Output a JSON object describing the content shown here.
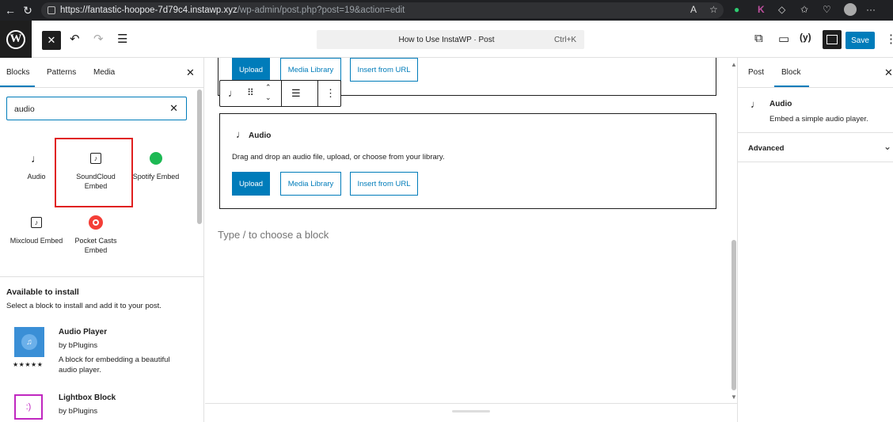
{
  "browser": {
    "url_host": "https://fantastic-hoopoe-7d79c4.instawp.xyz",
    "url_path": "/wp-admin/post.php?post=19&action=edit"
  },
  "topbar": {
    "doc_title": "How to Use InstaWP · Post",
    "shortcut": "Ctrl+K",
    "save_label": "Save"
  },
  "inserter": {
    "tabs": [
      "Blocks",
      "Patterns",
      "Media"
    ],
    "search_value": "audio",
    "results": [
      {
        "label": "Audio"
      },
      {
        "label": "SoundCloud Embed"
      },
      {
        "label": "Spotify Embed"
      },
      {
        "label": "Mixcloud Embed"
      },
      {
        "label": "Pocket Casts Embed"
      }
    ],
    "install_heading": "Available to install",
    "install_sub": "Select a block to install and add it to your post.",
    "plugins": [
      {
        "name": "Audio Player",
        "author": "by bPlugins",
        "desc": "A block for embedding a beautiful audio player.",
        "stars": "★★★★★"
      },
      {
        "name": "Lightbox Block",
        "author": "by bPlugins"
      }
    ]
  },
  "editor": {
    "upload": "Upload",
    "media_library": "Media Library",
    "insert_url": "Insert from URL",
    "audio_title": "Audio",
    "audio_instructions": "Drag and drop an audio file, upload, or choose from your library.",
    "appender": "Type / to choose a block"
  },
  "sidebar": {
    "tabs": [
      "Post",
      "Block"
    ],
    "block_name": "Audio",
    "block_desc": "Embed a simple audio player.",
    "advanced": "Advanced"
  },
  "colors": {
    "accent": "#007cba",
    "highlight": "#e02020",
    "browser_bar": "#202124"
  }
}
